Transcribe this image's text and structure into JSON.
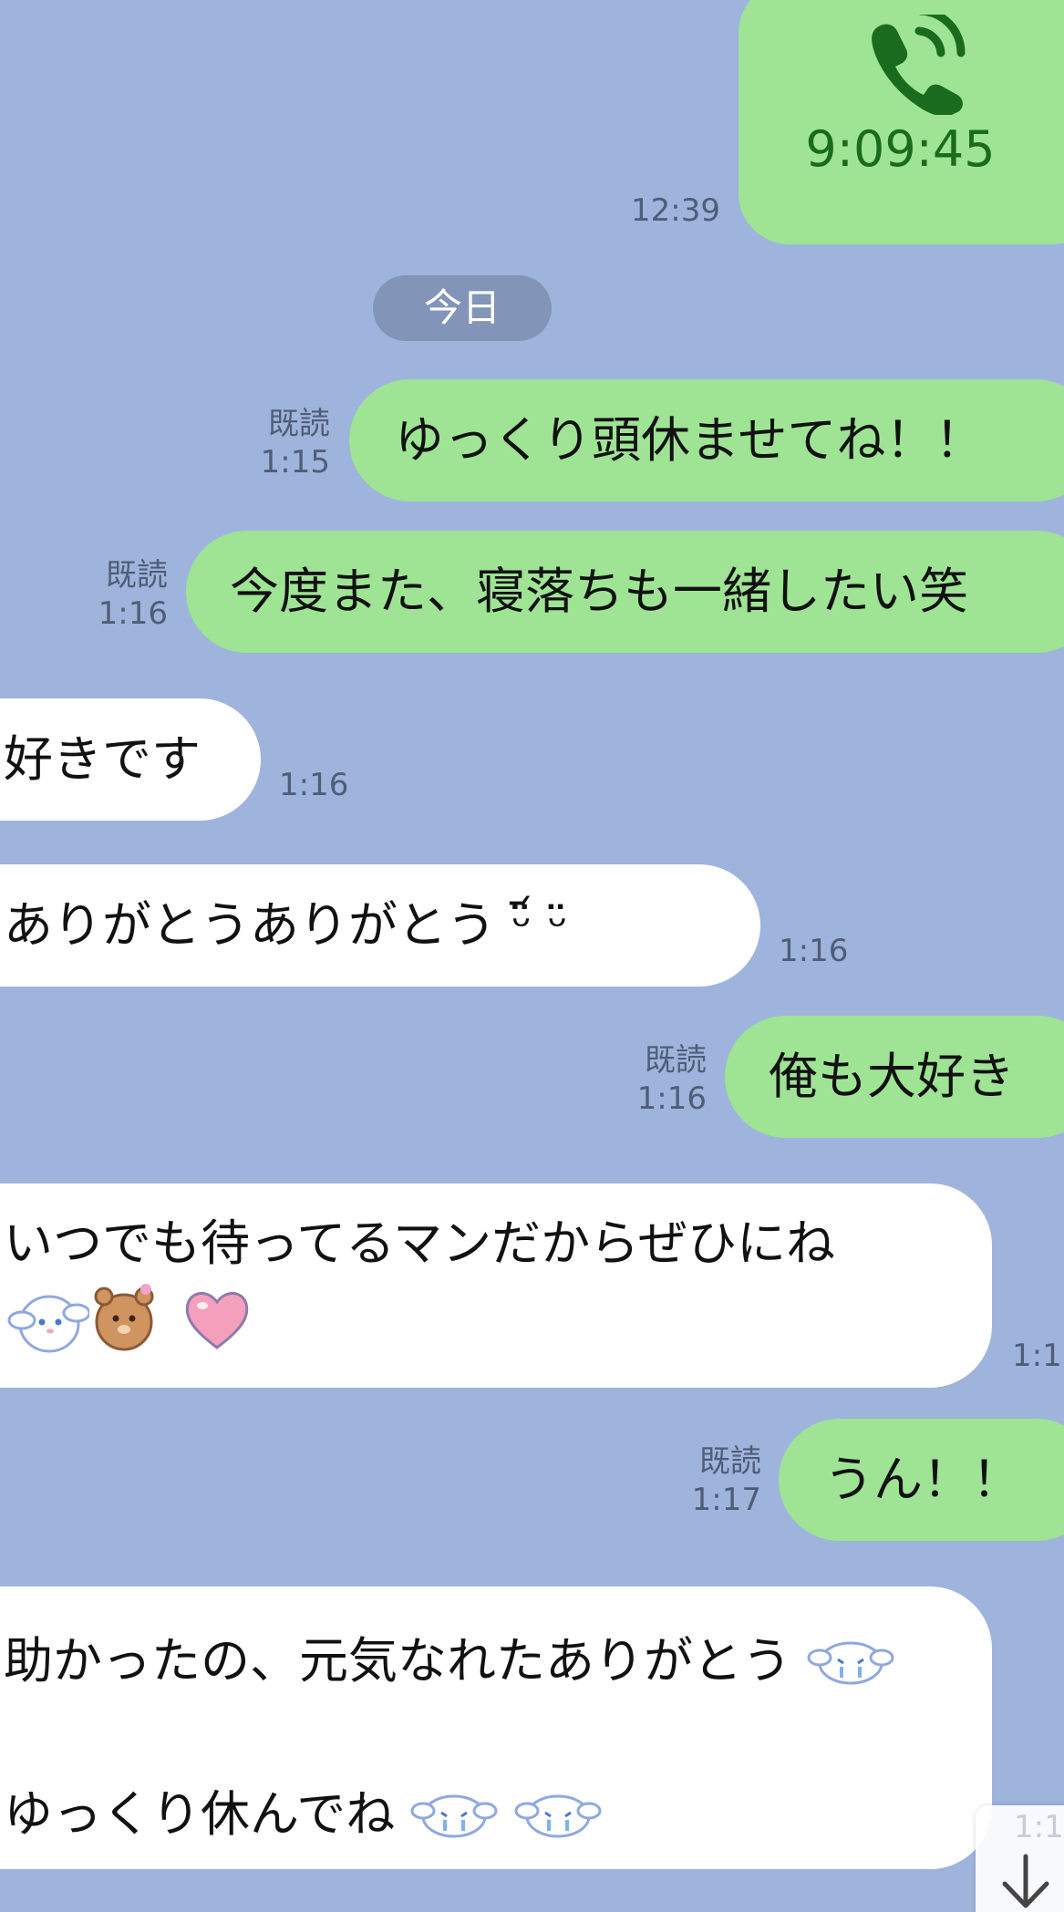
{
  "call": {
    "duration": "9:09:45",
    "time": "12:39"
  },
  "date_separator": "今日",
  "messages": [
    {
      "direction": "sent",
      "text": "ゆっくり頭休ませてね！！",
      "read": "既読",
      "time": "1:15"
    },
    {
      "direction": "sent",
      "text": "今度また、寝落ちも一緒したい笑",
      "read": "既読",
      "time": "1:16"
    },
    {
      "direction": "received",
      "text": "好きです",
      "time": "1:16"
    },
    {
      "direction": "received",
      "text": "ありがとうありがとう ᵕ̈᷄ ᵕ̈",
      "time": "1:16"
    },
    {
      "direction": "sent",
      "text": "俺も大好き",
      "read": "既読",
      "time": "1:16"
    },
    {
      "direction": "received",
      "text": "いつでも待ってるマンだからぜひにね",
      "time": "1:1"
    },
    {
      "direction": "sent",
      "text": "うん！！",
      "read": "既読",
      "time": "1:17"
    },
    {
      "direction": "received",
      "lines": [
        "助かったの、元気なれたありがとう",
        "ゆっくり休んでね"
      ]
    }
  ],
  "scroll_button": {
    "faint_time": "1:1"
  }
}
